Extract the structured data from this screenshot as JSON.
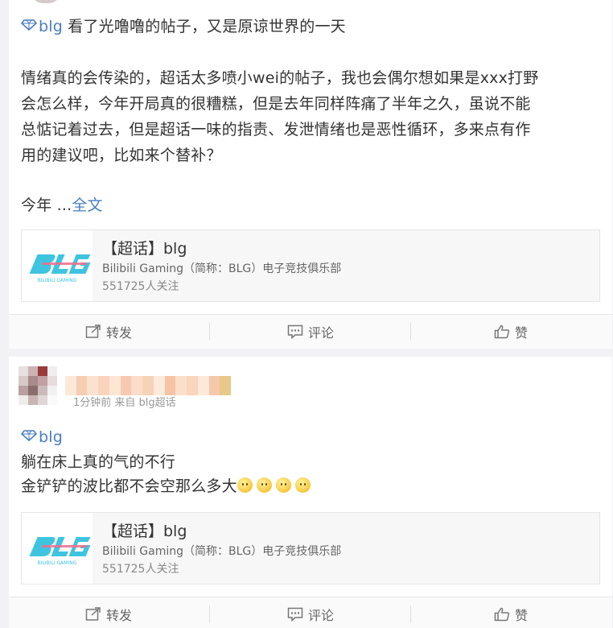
{
  "post1": {
    "topic": "blg",
    "headline": " 看了光噜噜的帖子，又是原谅世界的一天",
    "body_lines": [
      "情绪真的会传染的，超话太多喷小wei的帖子，我也会偶尔想如果是xxx打野",
      "会怎么样，今年开局真的很糟糕，但是去年同样阵痛了半年之久，虽说不能",
      "总惦记着过去，但是超话一味的指责、发泄情绪也是恶性循环，多来点有作",
      "用的建议吧，比如来个替补？"
    ],
    "last_line": "今年 ...",
    "full_text_link": "全文",
    "super_card": {
      "title": "【超话】blg",
      "desc": "Bilibili Gaming（简称：BLG）电子竞技俱乐部",
      "followers": "551725人关注"
    },
    "actions": {
      "repost": "转发",
      "comment": "评论",
      "like": "赞"
    }
  },
  "post2": {
    "meta": "1分钟前 来自 blg超话",
    "topic": "blg",
    "line1": "躺在床上真的气的不行",
    "line2": "金铲铲的波比都不会空那么多大",
    "super_card": {
      "title": "【超话】blg",
      "desc": "Bilibili Gaming（简称：BLG）电子竞技俱乐部",
      "followers": "551725人关注"
    },
    "actions": {
      "repost": "转发",
      "comment": "评论",
      "like": "赞"
    }
  },
  "logo": {
    "brand_color": "#3fc4e0",
    "accent_color": "#f06c8c"
  }
}
